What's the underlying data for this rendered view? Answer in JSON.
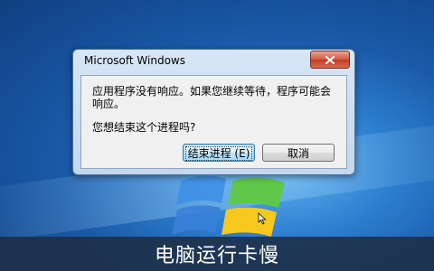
{
  "dialog": {
    "title": "Microsoft Windows",
    "message": "应用程序没有响应。如果您继续等待，程序可能会响应。",
    "question": "您想结束这个进程吗?",
    "end_process_label": "结束进程 (E)",
    "cancel_label": "取消"
  },
  "caption": "电脑运行卡慢",
  "icons": {
    "close": "close-icon",
    "windows_logo": "windows-logo",
    "cursor": "busy-cursor-icon"
  },
  "colors": {
    "desktop_blue": "#1a5aa8",
    "dialog_frame": "#c3d7ee",
    "close_red": "#c43a22",
    "caption_bar": "#1e2d46"
  }
}
